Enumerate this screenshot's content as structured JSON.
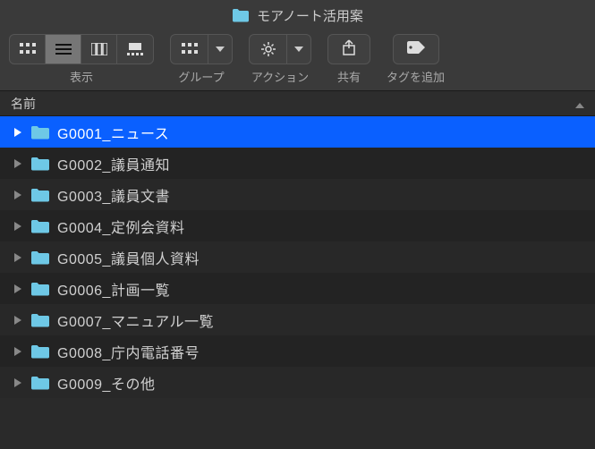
{
  "window": {
    "title": "モアノート活用案"
  },
  "toolbar": {
    "view_label": "表示",
    "group_label": "グループ",
    "action_label": "アクション",
    "share_label": "共有",
    "tag_label": "タグを追加"
  },
  "columns": {
    "name_label": "名前"
  },
  "rows": [
    {
      "name": "G0001_ニュース",
      "selected": true
    },
    {
      "name": "G0002_議員通知",
      "selected": false
    },
    {
      "name": "G0003_議員文書",
      "selected": false
    },
    {
      "name": "G0004_定例会資料",
      "selected": false
    },
    {
      "name": "G0005_議員個人資料",
      "selected": false
    },
    {
      "name": "G0006_計画一覧",
      "selected": false
    },
    {
      "name": "G0007_マニュアル一覧",
      "selected": false
    },
    {
      "name": "G0008_庁内電話番号",
      "selected": false
    },
    {
      "name": "G0009_その他",
      "selected": false
    }
  ],
  "colors": {
    "folder": "#6ec8e6",
    "selection": "#0a60ff"
  }
}
